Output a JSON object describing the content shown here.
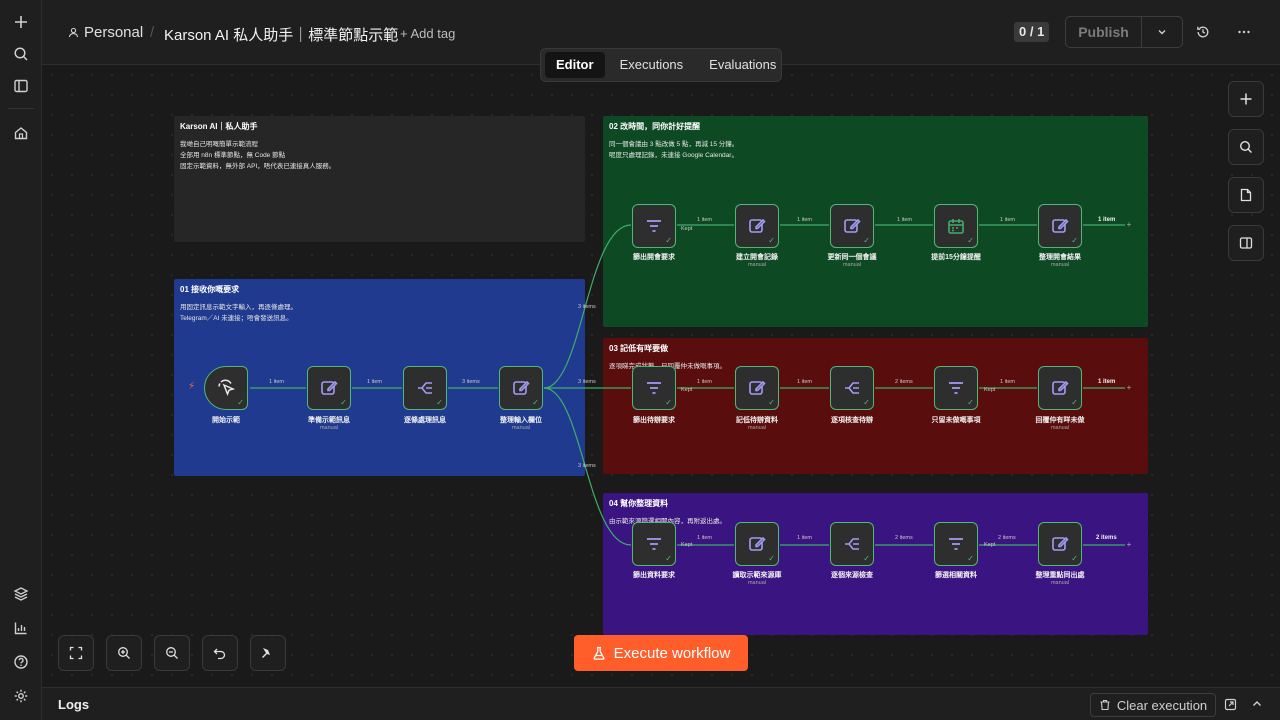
{
  "header": {
    "project": "Personal",
    "separator": "/",
    "title": "Karson AI 私人助手｜標準節點示範",
    "add_tag": "+ Add tag",
    "counter": "0 / 1",
    "publish": "Publish"
  },
  "tabs": [
    {
      "label": "Editor",
      "active": true
    },
    {
      "label": "Executions",
      "active": false
    },
    {
      "label": "Evaluations",
      "active": false
    }
  ],
  "stickies": {
    "intro": {
      "title": "Karson AI｜私人助手",
      "body": "我哋自己明嘅簡單示範流程\n全部用 n8n 標準節點，無 Code 節點\n固定示範資料，無外部 API，唔代表已連接真人服務。",
      "color": "#262626"
    },
    "s01": {
      "title": "01 接收你嘅要求",
      "body": "用固定訊息示範文字輸入，再逐條處理。\nTelegram／AI 未連接；唔會發送訊息。",
      "color": "#1f3a8f"
    },
    "s02": {
      "title": "02 改時間，同你計好提醒",
      "body": "同一個會議由 3 點改做 5 點，再減 15 分鐘。\n呢度只處理記錄，未連接 Google Calendar。",
      "color": "#0d4a24"
    },
    "s03": {
      "title": "03 記低有咩要做",
      "body": "逐項睇完成狀態，只回覆仲未做嘅事項。",
      "color": "#5a0d0d"
    },
    "s04": {
      "title": "04 幫你整理資料",
      "body": "由示範來源篩選相關內容，再附返出處。",
      "color": "#3a1480"
    }
  },
  "nodes": {
    "trigger": {
      "label": "開始示範",
      "icon": "cursor-click-icon"
    },
    "prep": {
      "label": "準備示範訊息",
      "sub": "manual",
      "icon": "edit-icon"
    },
    "split": {
      "label": "逐條處理訊息",
      "icon": "split-icon"
    },
    "fields": {
      "label": "整理輸入欄位",
      "sub": "manual",
      "icon": "edit-icon"
    },
    "r2": [
      {
        "label": "篩出開會要求",
        "icon": "filter-icon"
      },
      {
        "label": "建立開會記錄",
        "sub": "manual",
        "icon": "edit-icon"
      },
      {
        "label": "更新同一個會議",
        "sub": "manual",
        "icon": "edit-icon"
      },
      {
        "label": "提前15分鐘提醒",
        "icon": "calendar-icon"
      },
      {
        "label": "整理開會結果",
        "sub": "manual",
        "icon": "edit-icon"
      }
    ],
    "r3": [
      {
        "label": "篩出待辦要求",
        "icon": "filter-icon"
      },
      {
        "label": "記低待辦資料",
        "sub": "manual",
        "icon": "edit-icon"
      },
      {
        "label": "逐項核查待辦",
        "icon": "split-icon"
      },
      {
        "label": "只留未做嘅事項",
        "icon": "filter-icon"
      },
      {
        "label": "回覆仲有咩未做",
        "sub": "manual",
        "icon": "edit-icon"
      }
    ],
    "r4": [
      {
        "label": "篩出資料要求",
        "icon": "filter-icon"
      },
      {
        "label": "讀取示範來源庫",
        "sub": "manual",
        "icon": "edit-icon"
      },
      {
        "label": "逐個來源檢查",
        "icon": "split-icon"
      },
      {
        "label": "篩選相關資料",
        "icon": "filter-icon"
      },
      {
        "label": "整理重點同出處",
        "sub": "manual",
        "icon": "edit-icon"
      }
    ]
  },
  "connections": {
    "one_item": "1 item",
    "two_items": "2 items",
    "three_items": "3 items",
    "kept": "Kept"
  },
  "outputs": {
    "r2": "1 item",
    "r3": "1 item",
    "r4": "2 items"
  },
  "execute_button": "Execute workflow",
  "logs": {
    "title": "Logs",
    "clear": "Clear execution"
  },
  "colors": {
    "accent": "#ff5d2a",
    "success": "#4fb877",
    "node_icon": "#a29cf5"
  }
}
